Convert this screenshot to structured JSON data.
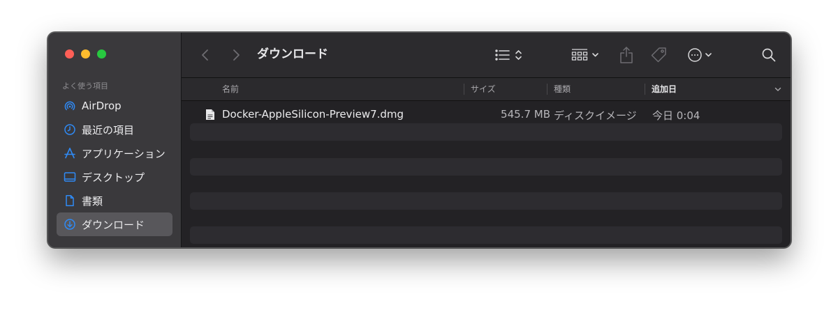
{
  "window": {
    "title": "ダウンロード"
  },
  "sidebar": {
    "header": "よく使う項目",
    "items": [
      {
        "label": "AirDrop",
        "icon": "airdrop-icon"
      },
      {
        "label": "最近の項目",
        "icon": "clock-icon"
      },
      {
        "label": "アプリケーション",
        "icon": "applications-icon"
      },
      {
        "label": "デスクトップ",
        "icon": "desktop-icon"
      },
      {
        "label": "書類",
        "icon": "document-icon"
      },
      {
        "label": "ダウンロード",
        "icon": "download-icon",
        "selected": true
      }
    ]
  },
  "toolbar": {
    "icons": [
      "back-icon",
      "forward-icon",
      "list-view-icon",
      "group-icon",
      "share-icon",
      "tag-icon",
      "more-icon",
      "search-icon"
    ]
  },
  "columns": {
    "name": "名前",
    "size": "サイズ",
    "kind": "種類",
    "date": "追加日"
  },
  "files": [
    {
      "name": "Docker-AppleSilicon-Preview7.dmg",
      "size": "545.7 MB",
      "kind": "ディスクイメージ",
      "date": "今日 0:04"
    }
  ],
  "colors": {
    "accent": "#2f8af5",
    "window_bg": "#242426",
    "sidebar_bg": "#3a393c"
  }
}
